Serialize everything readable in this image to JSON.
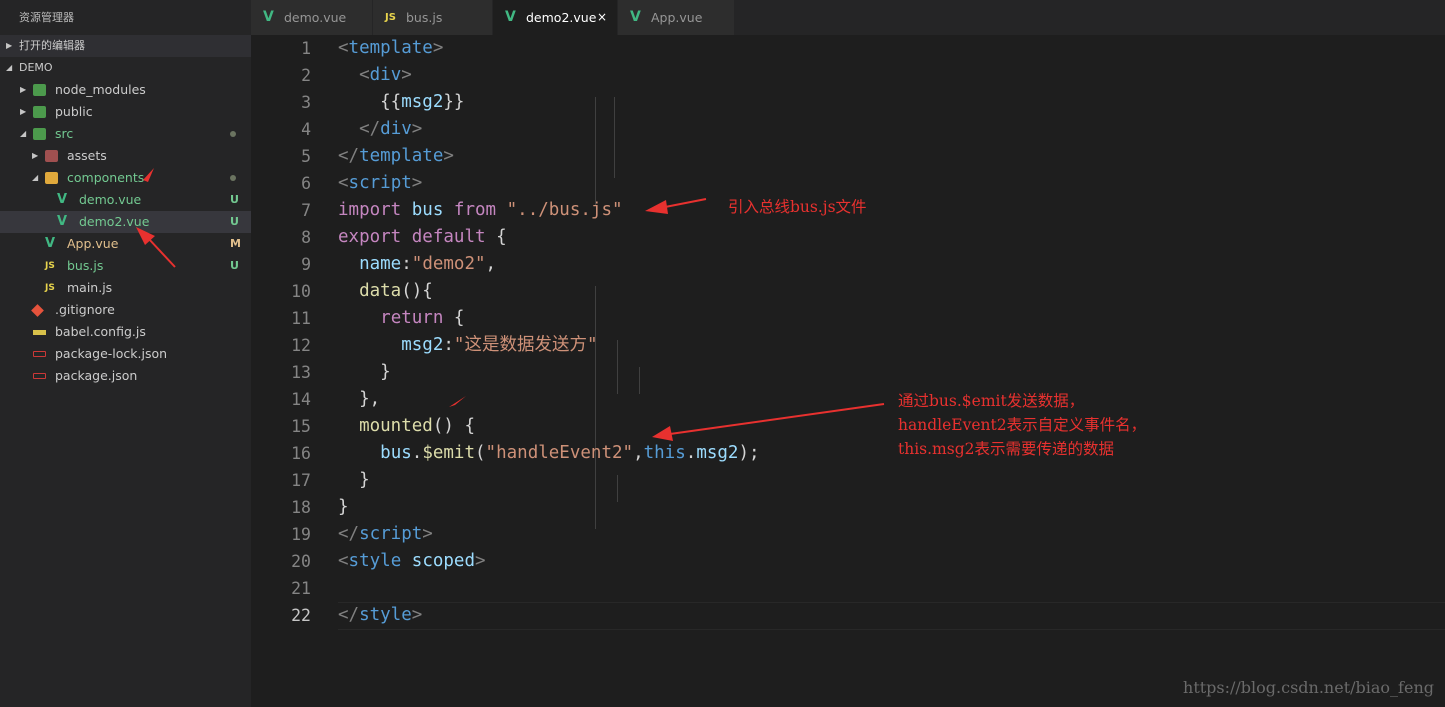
{
  "explorer": {
    "title": "资源管理器",
    "open_editors": "打开的编辑器",
    "project": "DEMO",
    "items": [
      {
        "label": "node_modules",
        "type": "folder",
        "state": "closed",
        "color": "#cccccc"
      },
      {
        "label": "public",
        "type": "folder",
        "state": "closed",
        "color": "#cccccc"
      },
      {
        "label": "src",
        "type": "folder",
        "state": "open",
        "color": "#73c991",
        "status": "dot"
      },
      {
        "label": "assets",
        "type": "folder",
        "state": "closed",
        "color": "#cccccc"
      },
      {
        "label": "components",
        "type": "folder",
        "state": "open",
        "color": "#73c991",
        "status": "dot"
      },
      {
        "label": "demo.vue",
        "type": "vue",
        "color": "#73c991",
        "badge": "U"
      },
      {
        "label": "demo2.vue",
        "type": "vue",
        "color": "#73c991",
        "badge": "U",
        "selected": true
      },
      {
        "label": "App.vue",
        "type": "vue",
        "color": "#e2c08d",
        "badge": "M"
      },
      {
        "label": "bus.js",
        "type": "js",
        "color": "#73c991",
        "badge": "U"
      },
      {
        "label": "main.js",
        "type": "js",
        "color": "#cccccc"
      },
      {
        "label": ".gitignore",
        "type": "git",
        "color": "#cccccc"
      },
      {
        "label": "babel.config.js",
        "type": "babel",
        "color": "#cccccc"
      },
      {
        "label": "package-lock.json",
        "type": "npm",
        "color": "#cccccc"
      },
      {
        "label": "package.json",
        "type": "npm",
        "color": "#cccccc"
      }
    ]
  },
  "tabs": [
    {
      "label": "demo.vue",
      "icon": "V",
      "active": false
    },
    {
      "label": "bus.js",
      "icon": "JS",
      "active": false
    },
    {
      "label": "demo2.vue",
      "icon": "V",
      "active": true,
      "close": "×"
    },
    {
      "label": "App.vue",
      "icon": "V",
      "active": false
    }
  ],
  "editor": {
    "current_line": 22,
    "lines": [
      [
        [
          "t-punc",
          "<"
        ],
        [
          "t-tag",
          "template"
        ],
        [
          "t-punc",
          ">"
        ]
      ],
      [
        [
          "t-plain",
          "  "
        ],
        [
          "t-punc",
          "<"
        ],
        [
          "t-tag",
          "div"
        ],
        [
          "t-punc",
          ">"
        ]
      ],
      [
        [
          "t-plain",
          "    {{"
        ],
        [
          "t-var",
          "msg2"
        ],
        [
          "t-plain",
          "}}"
        ]
      ],
      [
        [
          "t-plain",
          "  "
        ],
        [
          "t-punc",
          "</"
        ],
        [
          "t-tag",
          "div"
        ],
        [
          "t-punc",
          ">"
        ]
      ],
      [
        [
          "t-punc",
          "</"
        ],
        [
          "t-tag",
          "template"
        ],
        [
          "t-punc",
          ">"
        ]
      ],
      [
        [
          "t-punc",
          "<"
        ],
        [
          "t-tag",
          "script"
        ],
        [
          "t-punc",
          ">"
        ]
      ],
      [
        [
          "t-kw",
          "import"
        ],
        [
          "t-plain",
          " "
        ],
        [
          "t-var",
          "bus"
        ],
        [
          "t-plain",
          " "
        ],
        [
          "t-kw",
          "from"
        ],
        [
          "t-plain",
          " "
        ],
        [
          "t-str",
          "\"../bus.js\""
        ]
      ],
      [
        [
          "t-kw",
          "export"
        ],
        [
          "t-plain",
          " "
        ],
        [
          "t-kw",
          "default"
        ],
        [
          "t-plain",
          " {"
        ]
      ],
      [
        [
          "t-plain",
          "  "
        ],
        [
          "t-var",
          "name"
        ],
        [
          "t-plain",
          ":"
        ],
        [
          "t-str",
          "\"demo2\""
        ],
        [
          "t-plain",
          ","
        ]
      ],
      [
        [
          "t-plain",
          "  "
        ],
        [
          "t-fn",
          "data"
        ],
        [
          "t-plain",
          "(){"
        ]
      ],
      [
        [
          "t-plain",
          "    "
        ],
        [
          "t-kw",
          "return"
        ],
        [
          "t-plain",
          " {"
        ]
      ],
      [
        [
          "t-plain",
          "      "
        ],
        [
          "t-var",
          "msg2"
        ],
        [
          "t-plain",
          ":"
        ],
        [
          "t-str",
          "\"这是数据发送方\""
        ]
      ],
      [
        [
          "t-plain",
          "    }"
        ]
      ],
      [
        [
          "t-plain",
          "  },"
        ]
      ],
      [
        [
          "t-plain",
          "  "
        ],
        [
          "t-fn",
          "mounted"
        ],
        [
          "t-plain",
          "() {"
        ]
      ],
      [
        [
          "t-plain",
          "    "
        ],
        [
          "t-var",
          "bus"
        ],
        [
          "t-plain",
          "."
        ],
        [
          "t-fn",
          "$emit"
        ],
        [
          "t-plain",
          "("
        ],
        [
          "t-str",
          "\"handleEvent2\""
        ],
        [
          "t-plain",
          ","
        ],
        [
          "t-this",
          "this"
        ],
        [
          "t-plain",
          "."
        ],
        [
          "t-var",
          "msg2"
        ],
        [
          "t-plain",
          ");"
        ]
      ],
      [
        [
          "t-plain",
          "  }"
        ]
      ],
      [
        [
          "t-plain",
          "}"
        ]
      ],
      [
        [
          "t-punc",
          "</"
        ],
        [
          "t-tag",
          "script"
        ],
        [
          "t-punc",
          ">"
        ]
      ],
      [
        [
          "t-punc",
          "<"
        ],
        [
          "t-tag",
          "style"
        ],
        [
          "t-plain",
          " "
        ],
        [
          "t-var",
          "scoped"
        ],
        [
          "t-punc",
          ">"
        ]
      ],
      [
        [
          "t-plain",
          ""
        ]
      ],
      [
        [
          "t-punc",
          "</"
        ],
        [
          "t-tag",
          "style"
        ],
        [
          "t-punc",
          ">"
        ]
      ]
    ]
  },
  "annotations": {
    "import_note": "引入总线bus.js文件",
    "emit_note_lines": [
      "通过bus.$emit发送数据，",
      "handleEvent2表示自定义事件名，",
      "this.msg2表示需要传递的数据"
    ]
  },
  "watermark": "https://blog.csdn.net/biao_feng",
  "colors": {
    "annotation": "#e8312f",
    "vue_icon": "#41b883",
    "js_icon": "#e8d44d"
  }
}
